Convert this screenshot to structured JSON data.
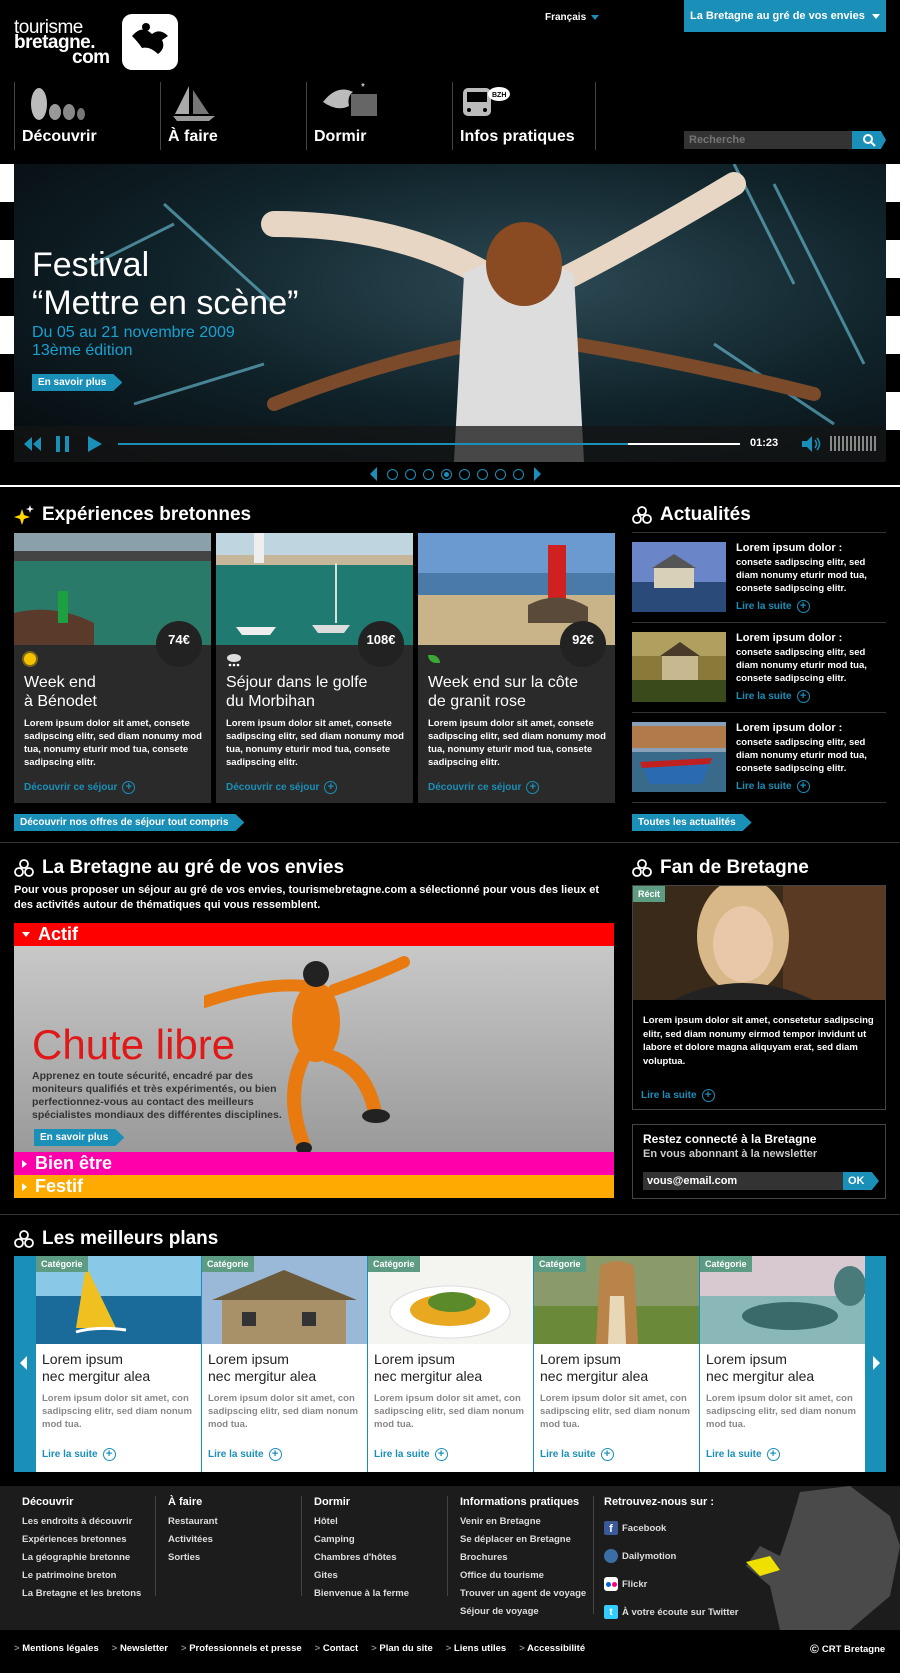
{
  "header": {
    "logo_line1": "tourisme",
    "logo_line2": "bretagne.",
    "logo_line3": "com",
    "language": "Français",
    "envies_button": "La Bretagne au gré de vos envies",
    "search_placeholder": "Recherche"
  },
  "nav": {
    "items": [
      {
        "label": "Découvrir",
        "icon": "standing-stones-icon"
      },
      {
        "label": "À faire",
        "icon": "sailboat-icon"
      },
      {
        "label": "Dormir",
        "icon": "sleeping-moon-icon"
      },
      {
        "label": "Infos pratiques",
        "icon": "bus-info-icon"
      }
    ]
  },
  "hero": {
    "title1": "Festival",
    "title2": "“Mettre en scène”",
    "date": "Du 05 au 21 novembre 2009",
    "edition": "13ème édition",
    "cta": "En savoir plus",
    "time": "01:23",
    "progress": 0.82,
    "slides": 8,
    "active_slide": 4
  },
  "experiences": {
    "title": "Expériences bretonnes",
    "cards": [
      {
        "price": "74€",
        "weather": "sun-icon",
        "title1": "Week end",
        "title2": "à Bénodet",
        "text": "Lorem ipsum dolor sit amet, consete sadipscing elitr, sed diam nonumy mod tua, nonumy eturir mod tua, consete sadipscing elitr.",
        "link": "Découvrir ce séjour"
      },
      {
        "price": "108€",
        "weather": "snow-cloud-icon",
        "title1": "Séjour dans le golfe",
        "title2": "du Morbihan",
        "text": "Lorem ipsum dolor sit amet, consete sadipscing elitr, sed diam nonumy mod tua, nonumy eturir mod tua, consete sadipscing elitr.",
        "link": "Découvrir ce séjour"
      },
      {
        "price": "92€",
        "weather": "leaf-icon",
        "title1": "Week end sur la côte",
        "title2": "de granit rose",
        "text": "Lorem ipsum dolor sit amet, consete sadipscing elitr, sed diam nonumy mod tua, nonumy eturir mod tua, consete sadipscing elitr.",
        "link": "Découvrir ce séjour"
      }
    ],
    "all_link": "Découvrir nos offres de séjour tout compris"
  },
  "news": {
    "title": "Actualités",
    "items": [
      {
        "heading": "Lorem ipsum dolor :",
        "text": "consete sadipscing elitr, sed diam nonumy eturir mod tua, consete sadipscing elitr.",
        "link": "Lire la suite"
      },
      {
        "heading": "Lorem ipsum dolor :",
        "text": "consete sadipscing elitr, sed diam nonumy eturir mod tua, consete sadipscing elitr.",
        "link": "Lire la suite"
      },
      {
        "heading": "Lorem ipsum dolor :",
        "text": "consete sadipscing elitr, sed diam nonumy eturir mod tua, consete sadipscing elitr.",
        "link": "Lire la suite"
      }
    ],
    "all_link": "Toutes les actualités"
  },
  "envies": {
    "title": "La Bretagne au gré de vos envies",
    "intro": "Pour vous proposer un séjour au gré de vos envies, tourismebretagne.com a sélectionné pour vous des lieux et des activités autour de thématiques qui vous ressemblent.",
    "tab_actif": "Actif",
    "feature_title": "Chute libre",
    "feature_text": "Apprenez en toute sécurité, encadré par des moniteurs qualifiés et très expérimentés, ou bien perfectionnez-vous au contact des meilleurs spécialistes mondiaux des différentes disciplines.",
    "cta": "En savoir plus",
    "tab_bien_etre": "Bien être",
    "tab_festif": "Festif"
  },
  "fan": {
    "title": "Fan de Bretagne",
    "badge": "Récit",
    "text": "Lorem ipsum dolor sit amet, consetetur sadipscing elitr, sed diam nonumy eirmod tempor invidunt ut labore et dolore magna aliquyam erat, sed diam voluptua.",
    "link": "Lire la suite"
  },
  "newsletter": {
    "title": "Restez connecté à la Bretagne",
    "subtitle": "En vous abonnant à la newsletter",
    "email": "vous@email.com",
    "ok": "OK"
  },
  "plans": {
    "title": "Les meilleurs plans",
    "items": [
      {
        "category": "Catégorie",
        "title1": "Lorem ipsum",
        "title2": "nec mergitur alea",
        "text": "Lorem ipsum dolor sit amet, con sadipscing elitr, sed diam nonum mod tua.",
        "link": "Lire la suite"
      },
      {
        "category": "Catégorie",
        "title1": "Lorem ipsum",
        "title2": "nec mergitur alea",
        "text": "Lorem ipsum dolor sit amet, con sadipscing elitr, sed diam nonum mod tua.",
        "link": "Lire la suite"
      },
      {
        "category": "Catégorie",
        "title1": "Lorem ipsum",
        "title2": "nec mergitur alea",
        "text": "Lorem ipsum dolor sit amet, con sadipscing elitr, sed diam nonum mod tua.",
        "link": "Lire la suite"
      },
      {
        "category": "Catégorie",
        "title1": "Lorem ipsum",
        "title2": "nec mergitur alea",
        "text": "Lorem ipsum dolor sit amet, con sadipscing elitr, sed diam nonum mod tua.",
        "link": "Lire la suite"
      },
      {
        "category": "Catégorie",
        "title1": "Lorem ipsum",
        "title2": "nec mergitur alea",
        "text": "Lorem ipsum dolor sit amet, con sadipscing elitr, sed diam nonum mod tua.",
        "link": "Lire la suite"
      }
    ]
  },
  "footer": {
    "columns": [
      {
        "heading": "Découvrir",
        "links": [
          "Les endroits à découvrir",
          "Expériences bretonnes",
          "La géographie bretonne",
          "Le patrimoine breton",
          "La Bretagne et les bretons"
        ]
      },
      {
        "heading": "À faire",
        "links": [
          "Restaurant",
          "Activitées",
          "Sorties"
        ]
      },
      {
        "heading": "Dormir",
        "links": [
          "Hôtel",
          "Camping",
          "Chambres d'hôtes",
          "Gites",
          "Bienvenue à la ferme"
        ]
      },
      {
        "heading": "Informations pratiques",
        "links": [
          "Venir en Bretagne",
          "Se déplacer en Bretagne",
          "Brochures",
          "Office du tourisme",
          "Trouver un agent de voyage",
          "Séjour de voyage"
        ]
      }
    ],
    "social_heading": "Retrouvez-nous sur :",
    "social": [
      {
        "label": "Facebook",
        "icon": "facebook-icon",
        "color": "#3b5998"
      },
      {
        "label": "Dailymotion",
        "icon": "dailymotion-icon",
        "color": "#3a6ea5"
      },
      {
        "label": "Flickr",
        "icon": "flickr-icon",
        "color": "#ff0084"
      },
      {
        "label": "À votre écoute sur Twitter",
        "icon": "twitter-icon",
        "color": "#33ccff"
      }
    ],
    "bottom_links": [
      "Mentions légales",
      "Newsletter",
      "Professionnels et presse",
      "Contact",
      "Plan du site",
      "Liens utiles",
      "Accessibilité"
    ],
    "copyright": "CRT Bretagne"
  },
  "colors": {
    "accent": "#1a8fb8",
    "actif": "#ff0000",
    "bien_etre": "#ff00aa",
    "festif": "#ffaa00",
    "category": "#5d9c83"
  }
}
